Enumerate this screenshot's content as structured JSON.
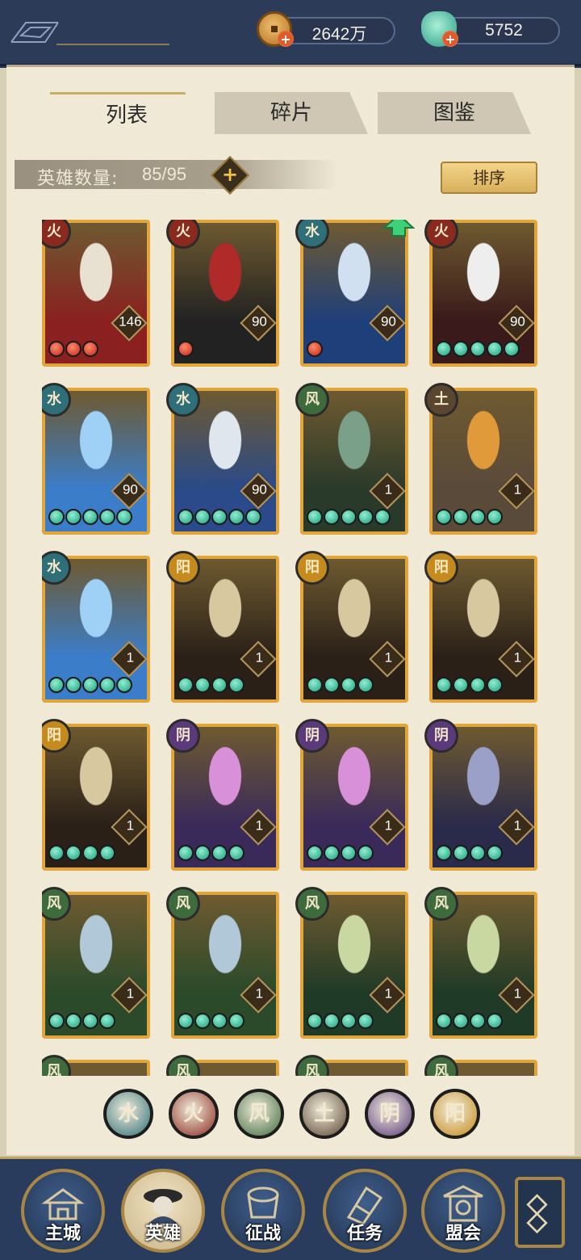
{
  "currency": [
    {
      "name": "copper-coin",
      "value": "2642万",
      "color": "#c98a2a"
    },
    {
      "name": "jade-pouch",
      "value": "5752",
      "color": "#4cc0a6"
    }
  ],
  "tabs": [
    {
      "label": "列表",
      "active": true
    },
    {
      "label": "碎片",
      "active": false
    },
    {
      "label": "图鉴",
      "active": false
    }
  ],
  "hero_count": {
    "label": "英雄数量:",
    "value": "85/95"
  },
  "sort_label": "排序",
  "element_colors": {
    "水": "#2f6f78",
    "火": "#8a2a1e",
    "风": "#3d6b3c",
    "土": "#5a4630",
    "阴": "#5a3a7a",
    "阳": "#c58b1c"
  },
  "heroes": [
    {
      "element": "火",
      "level": "146",
      "stars": 3,
      "star_color": "red",
      "art": [
        "#8a2020",
        "#e8e0d0"
      ]
    },
    {
      "element": "火",
      "level": "90",
      "stars": 1,
      "star_color": "red",
      "art": [
        "#222222",
        "#b02a2a"
      ]
    },
    {
      "element": "水",
      "level": "90",
      "stars": 1,
      "star_color": "red",
      "art": [
        "#1f3f7a",
        "#d0e0f0"
      ],
      "upgrade": true
    },
    {
      "element": "火",
      "level": "90",
      "stars": 5,
      "star_color": "green",
      "art": [
        "#3a1a1a",
        "#eeeeee"
      ]
    },
    {
      "element": "水",
      "level": "90",
      "stars": 5,
      "star_color": "green",
      "art": [
        "#3b7dc9",
        "#9fd0f5"
      ]
    },
    {
      "element": "水",
      "level": "90",
      "stars": 5,
      "star_color": "green",
      "art": [
        "#2a4a8a",
        "#e0e6ee"
      ]
    },
    {
      "element": "风",
      "level": "1",
      "stars": 5,
      "star_color": "green",
      "art": [
        "#2a3a2a",
        "#7aa08a"
      ]
    },
    {
      "element": "土",
      "level": "1",
      "stars": 4,
      "star_color": "green",
      "art": [
        "#5a4a3a",
        "#e09a3a"
      ]
    },
    {
      "element": "水",
      "level": "1",
      "stars": 5,
      "star_color": "green",
      "art": [
        "#3b7dc9",
        "#9fd0f5"
      ]
    },
    {
      "element": "阳",
      "level": "1",
      "stars": 4,
      "star_color": "green",
      "art": [
        "#2a2018",
        "#d8c8a0"
      ]
    },
    {
      "element": "阳",
      "level": "1",
      "stars": 4,
      "star_color": "green",
      "art": [
        "#2a2018",
        "#d8c8a0"
      ]
    },
    {
      "element": "阳",
      "level": "1",
      "stars": 4,
      "star_color": "green",
      "art": [
        "#2a2018",
        "#d8c8a0"
      ]
    },
    {
      "element": "阳",
      "level": "1",
      "stars": 4,
      "star_color": "green",
      "art": [
        "#2a2018",
        "#d8c8a0"
      ]
    },
    {
      "element": "阴",
      "level": "1",
      "stars": 4,
      "star_color": "green",
      "art": [
        "#3a2a5a",
        "#d890d8"
      ]
    },
    {
      "element": "阴",
      "level": "1",
      "stars": 4,
      "star_color": "green",
      "art": [
        "#3a2a5a",
        "#d890d8"
      ]
    },
    {
      "element": "阴",
      "level": "1",
      "stars": 4,
      "star_color": "green",
      "art": [
        "#2a2a4a",
        "#9aa0c8"
      ]
    },
    {
      "element": "风",
      "level": "1",
      "stars": 4,
      "star_color": "green",
      "art": [
        "#2a4a2a",
        "#b0c8d8"
      ]
    },
    {
      "element": "风",
      "level": "1",
      "stars": 4,
      "star_color": "green",
      "art": [
        "#2a4a2a",
        "#b0c8d8"
      ]
    },
    {
      "element": "风",
      "level": "1",
      "stars": 4,
      "star_color": "green",
      "art": [
        "#1f3a26",
        "#c8d8a0"
      ]
    },
    {
      "element": "风",
      "level": "1",
      "stars": 4,
      "star_color": "green",
      "art": [
        "#1f3a26",
        "#c8d8a0"
      ]
    },
    {
      "element": "风",
      "level": "",
      "stars": 0,
      "star_color": "green",
      "art": [
        "#6a5530",
        "#6a5530"
      ]
    },
    {
      "element": "风",
      "level": "",
      "stars": 0,
      "star_color": "green",
      "art": [
        "#6a5530",
        "#6a5530"
      ]
    },
    {
      "element": "风",
      "level": "",
      "stars": 0,
      "star_color": "green",
      "art": [
        "#6a5530",
        "#6a5530"
      ]
    },
    {
      "element": "风",
      "level": "",
      "stars": 0,
      "star_color": "green",
      "art": [
        "#6a5530",
        "#6a5530"
      ]
    }
  ],
  "element_filters": [
    "水",
    "火",
    "风",
    "土",
    "阴",
    "阳"
  ],
  "nav": [
    {
      "label": "主城",
      "icon": "city-gate-icon",
      "active": false
    },
    {
      "label": "英雄",
      "icon": "hero-portrait-icon",
      "active": true
    },
    {
      "label": "征战",
      "icon": "war-drum-icon",
      "active": false
    },
    {
      "label": "任务",
      "icon": "quest-scroll-icon",
      "active": false
    },
    {
      "label": "盟会",
      "icon": "alliance-pavilion-icon",
      "active": false
    }
  ]
}
